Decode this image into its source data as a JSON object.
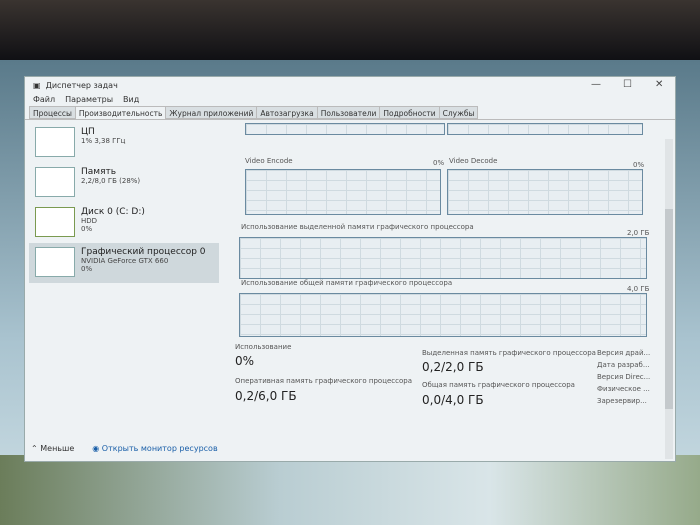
{
  "window": {
    "title": "Диспетчер задач",
    "minimize": "—",
    "maximize": "☐",
    "close": "✕"
  },
  "menu": [
    "Файл",
    "Параметры",
    "Вид"
  ],
  "tabs": [
    "Процессы",
    "Производительность",
    "Журнал приложений",
    "Автозагрузка",
    "Пользователи",
    "Подробности",
    "Службы"
  ],
  "sidebar": [
    {
      "name": "ЦП",
      "sub": "1% 3,38 ГГц",
      "sub2": ""
    },
    {
      "name": "Память",
      "sub": "2,2/8,0 ГБ (28%)",
      "sub2": ""
    },
    {
      "name": "Диск 0 (C: D:)",
      "sub": "HDD",
      "sub2": "0%"
    },
    {
      "name": "Графический процессор 0",
      "sub": "NVIDIA GeForce GTX 660",
      "sub2": "0%"
    }
  ],
  "graphs": {
    "video_encode": "Video Encode",
    "video_encode_pct": "0%",
    "video_decode": "Video Decode",
    "video_decode_pct": "0%",
    "dedicated": "Использование выделенной памяти графического процессора",
    "dedicated_max": "2,0 ГБ",
    "shared": "Использование общей памяти графического процессора",
    "shared_max": "4,0 ГБ"
  },
  "stats": {
    "usage_label": "Использование",
    "usage": "0%",
    "gpu_mem_label": "Оперативная память графического процессора",
    "gpu_mem": "0,2/6,0 ГБ",
    "ded_label": "Выделенная память графического процессора",
    "ded": "0,2/2,0 ГБ",
    "shared_label": "Общая память графического процессора",
    "shared": "0,0/4,0 ГБ",
    "info": [
      "Версия драй...",
      "Дата разраб...",
      "Версия Direc...",
      "Физическое ...",
      "Зарезервир..."
    ]
  },
  "footer": {
    "less": "Меньше",
    "monitor": "Открыть монитор ресурсов"
  }
}
